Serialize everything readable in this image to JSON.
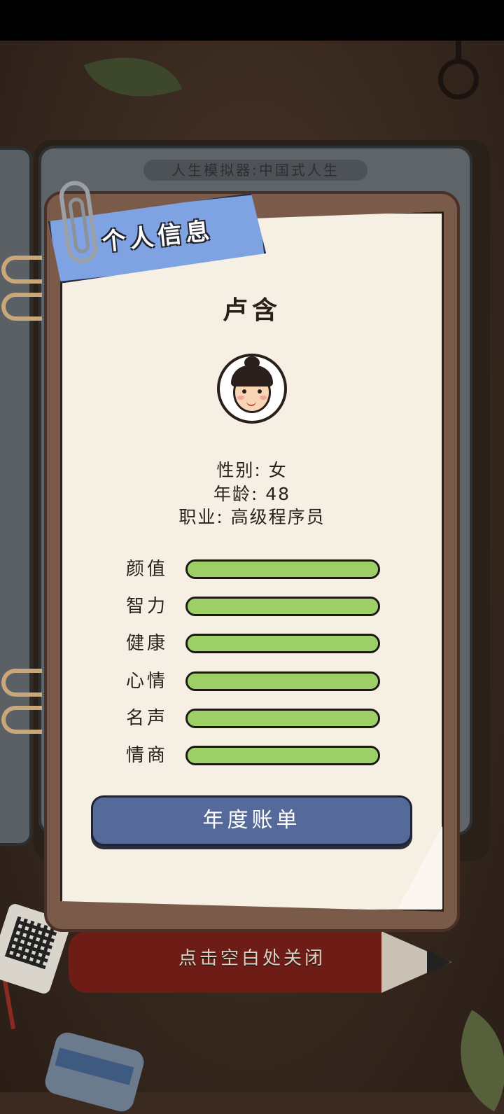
{
  "game": {
    "book_title": "人生模拟器:中国式人生",
    "close_hint": "点击空白处关闭"
  },
  "profile": {
    "header": "个人信息",
    "name": "卢含",
    "gender_line": "性别: 女",
    "age_line": "年龄: 48",
    "job_line": "职业: 高级程序员"
  },
  "stats": [
    {
      "label": "颜值",
      "level": 1.0
    },
    {
      "label": "智力",
      "level": 1.0
    },
    {
      "label": "健康",
      "level": 1.0
    },
    {
      "label": "心情",
      "level": 1.0
    },
    {
      "label": "名声",
      "level": 1.0
    },
    {
      "label": "情商",
      "level": 1.0
    }
  ],
  "actions": {
    "annual_bill": "年度账单"
  },
  "colors": {
    "ribbon": "#7fa2e3",
    "bar_fill": "#9ccf65",
    "button": "#55699a",
    "paper": "#f6efe3"
  }
}
